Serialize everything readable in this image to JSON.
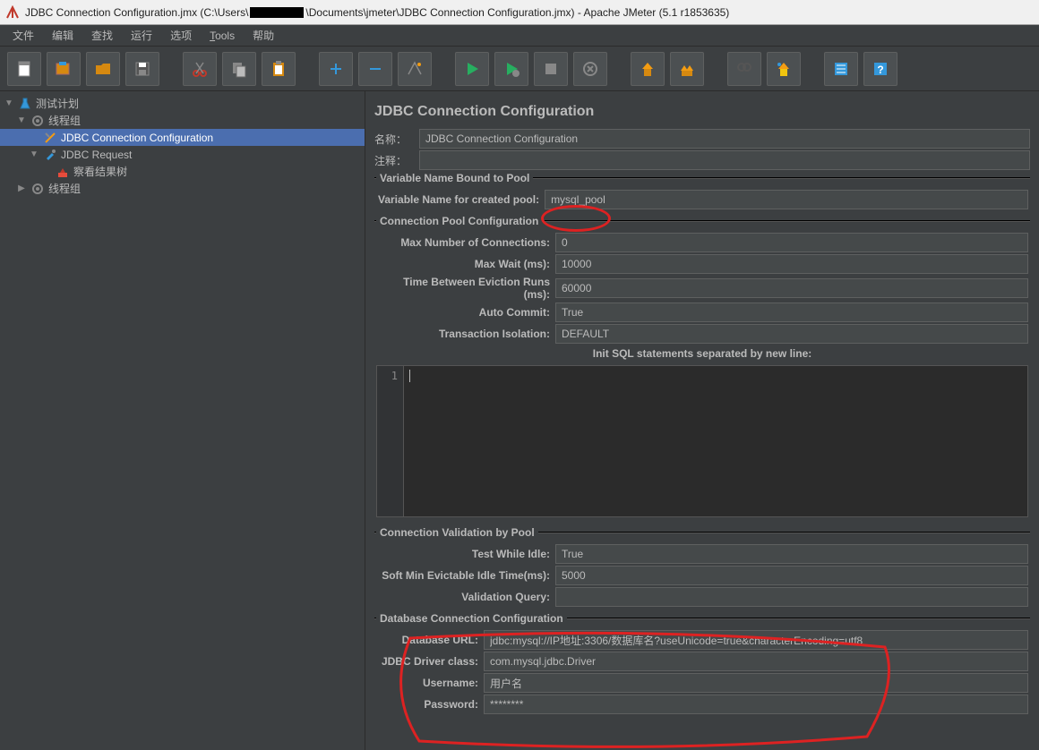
{
  "title": {
    "prefix": "JDBC Connection Configuration.jmx (C:\\Users\\",
    "suffix": "\\Documents\\jmeter\\JDBC Connection Configuration.jmx) - Apache JMeter (5.1 r1853635)"
  },
  "menu": [
    "文件",
    "编辑",
    "查找",
    "运行",
    "选项",
    "Tools",
    "帮助"
  ],
  "toolbar_icons": [
    "new-file-icon",
    "open-template-icon",
    "open-folder-icon",
    "save-icon",
    "",
    "cut-icon",
    "copy-icon",
    "paste-icon",
    "",
    "expand-icon",
    "collapse-icon",
    "toggle-icon",
    "",
    "start-icon",
    "start-no-pause-icon",
    "stop-icon",
    "shutdown-icon",
    "",
    "clear-icon",
    "clear-all-icon",
    "",
    "search-icon",
    "reset-search-icon",
    "",
    "function-helper-icon",
    "help-icon"
  ],
  "tree": {
    "root": "测试计划",
    "tg1": "线程组",
    "jdbc_conn": "JDBC Connection Configuration",
    "jdbc_req": "JDBC Request",
    "results": "察看结果树",
    "tg2": "线程组"
  },
  "panel": {
    "title": "JDBC Connection Configuration",
    "name_label": "名称：",
    "name_value": "JDBC Connection Configuration",
    "comment_label": "注释：",
    "comment_value": ""
  },
  "group1": {
    "legend": "Variable Name Bound to Pool",
    "var_label": "Variable Name for created pool:",
    "var_value": "mysql_pool"
  },
  "group2": {
    "legend": "Connection Pool Configuration",
    "max_conn_label": "Max Number of Connections:",
    "max_conn_value": "0",
    "max_wait_label": "Max Wait (ms):",
    "max_wait_value": "10000",
    "time_between_label": "Time Between Eviction Runs (ms):",
    "time_between_value": "60000",
    "auto_commit_label": "Auto Commit:",
    "auto_commit_value": "True",
    "tx_iso_label": "Transaction Isolation:",
    "tx_iso_value": "DEFAULT",
    "init_sql_label": "Init SQL statements separated by new line:",
    "gutter_line": "1"
  },
  "group3": {
    "legend": "Connection Validation by Pool",
    "test_idle_label": "Test While Idle:",
    "test_idle_value": "True",
    "soft_min_label": "Soft Min Evictable Idle Time(ms):",
    "soft_min_value": "5000",
    "validation_label": "Validation Query:",
    "validation_value": ""
  },
  "group4": {
    "legend": "Database Connection Configuration",
    "db_url_label": "Database URL:",
    "db_url_value": "jdbc:mysql://IP地址:3306/数据库名?useUnicode=true&characterEncoding=utf8",
    "driver_label": "JDBC Driver class:",
    "driver_value": "com.mysql.jdbc.Driver",
    "user_label": "Username:",
    "user_value": "用户名",
    "pass_label": "Password:",
    "pass_value": "********"
  }
}
